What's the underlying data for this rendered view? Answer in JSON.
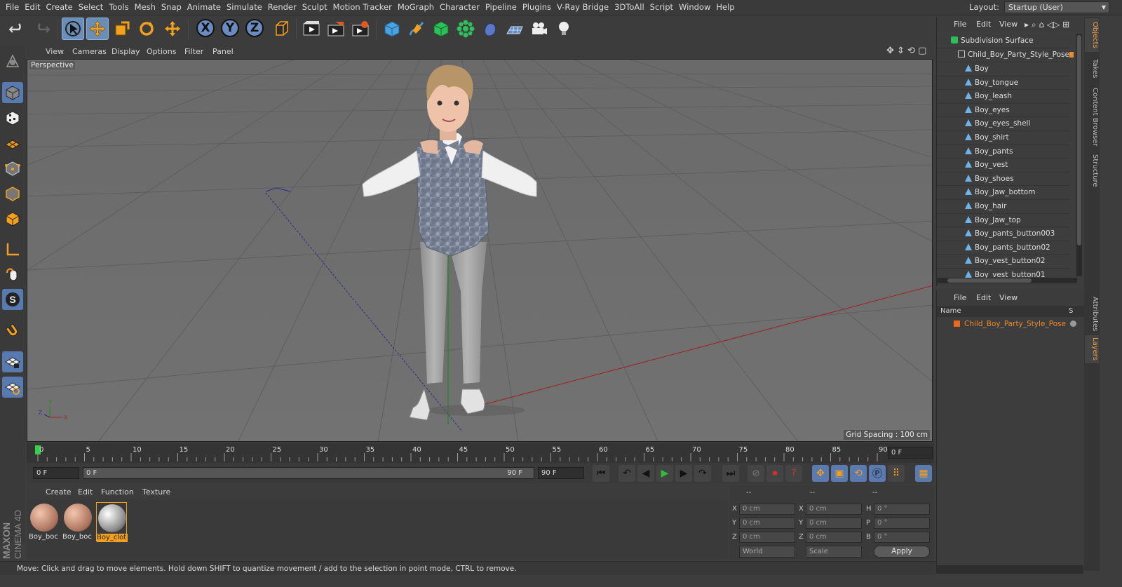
{
  "menu": [
    "File",
    "Edit",
    "Create",
    "Select",
    "Tools",
    "Mesh",
    "Snap",
    "Animate",
    "Simulate",
    "Render",
    "Sculpt",
    "Motion Tracker",
    "MoGraph",
    "Character",
    "Pipeline",
    "Plugins",
    "V-Ray Bridge",
    "3DToAll",
    "Script",
    "Window",
    "Help"
  ],
  "layout": {
    "label": "Layout:",
    "value": "Startup (User)"
  },
  "axes": [
    "X",
    "Y",
    "Z"
  ],
  "viewport": {
    "menu": [
      "View",
      "Cameras",
      "Display",
      "Options",
      "Filter",
      "Panel"
    ],
    "label": "Perspective",
    "grid_spacing": "Grid Spacing : 100 cm"
  },
  "timeline": {
    "ticks": [
      "0",
      "5",
      "10",
      "15",
      "20",
      "25",
      "30",
      "35",
      "40",
      "45",
      "50",
      "55",
      "60",
      "65",
      "70",
      "75",
      "80",
      "85",
      "90"
    ],
    "current_frame": "0 F",
    "start_field": "0 F",
    "range_start": "0 F",
    "range_end": "90 F",
    "end_field": "90 F"
  },
  "materials": {
    "menu": [
      "Create",
      "Edit",
      "Function",
      "Texture"
    ],
    "items": [
      "Boy_boc",
      "Boy_boc",
      "Boy_clot"
    ]
  },
  "coords": {
    "headers": [
      "--",
      "--",
      "--"
    ],
    "rows": [
      {
        "l1": "X",
        "v1": "0 cm",
        "l2": "X",
        "v2": "0 cm",
        "l3": "H",
        "v3": "0 °"
      },
      {
        "l1": "Y",
        "v1": "0 cm",
        "l2": "Y",
        "v2": "0 cm",
        "l3": "P",
        "v3": "0 °"
      },
      {
        "l1": "Z",
        "v1": "0 cm",
        "l2": "Z",
        "v2": "0 cm",
        "l3": "B",
        "v3": "0 °"
      }
    ],
    "mode1": "World",
    "mode2": "Scale",
    "apply": "Apply"
  },
  "status": "Move: Click and drag to move elements. Hold down SHIFT to quantize movement / add to the selection in point mode, CTRL to remove.",
  "objects": {
    "menu": [
      "File",
      "Edit",
      "View"
    ],
    "root": "Subdivision Surface",
    "group": "Child_Boy_Party_Style_Pose",
    "children": [
      "Boy",
      "Boy_tongue",
      "Boy_leash",
      "Boy_eyes",
      "Boy_eyes_shell",
      "Boy_shirt",
      "Boy_pants",
      "Boy_vest",
      "Boy_shoes",
      "Boy_Jaw_bottom",
      "Boy_hair",
      "Boy_Jaw_top",
      "Boy_pants_button003",
      "Boy_pants_button02",
      "Boy_vest_button02",
      "Boy_vest_button01"
    ]
  },
  "layers": {
    "menu": [
      "File",
      "Edit",
      "View"
    ],
    "col_name": "Name",
    "col_s": "S",
    "row": "Child_Boy_Party_Style_Pose"
  },
  "side_tabs": [
    "Objects",
    "Takes",
    "Content Browser",
    "Structure",
    "Attributes",
    "Layers"
  ],
  "brand": [
    "MAXON",
    "CINEMA 4D"
  ],
  "colors": {
    "accent": "#f08a2a",
    "active_tool": "#6a8eb8",
    "viewport_bg": "#6e6e6e"
  }
}
